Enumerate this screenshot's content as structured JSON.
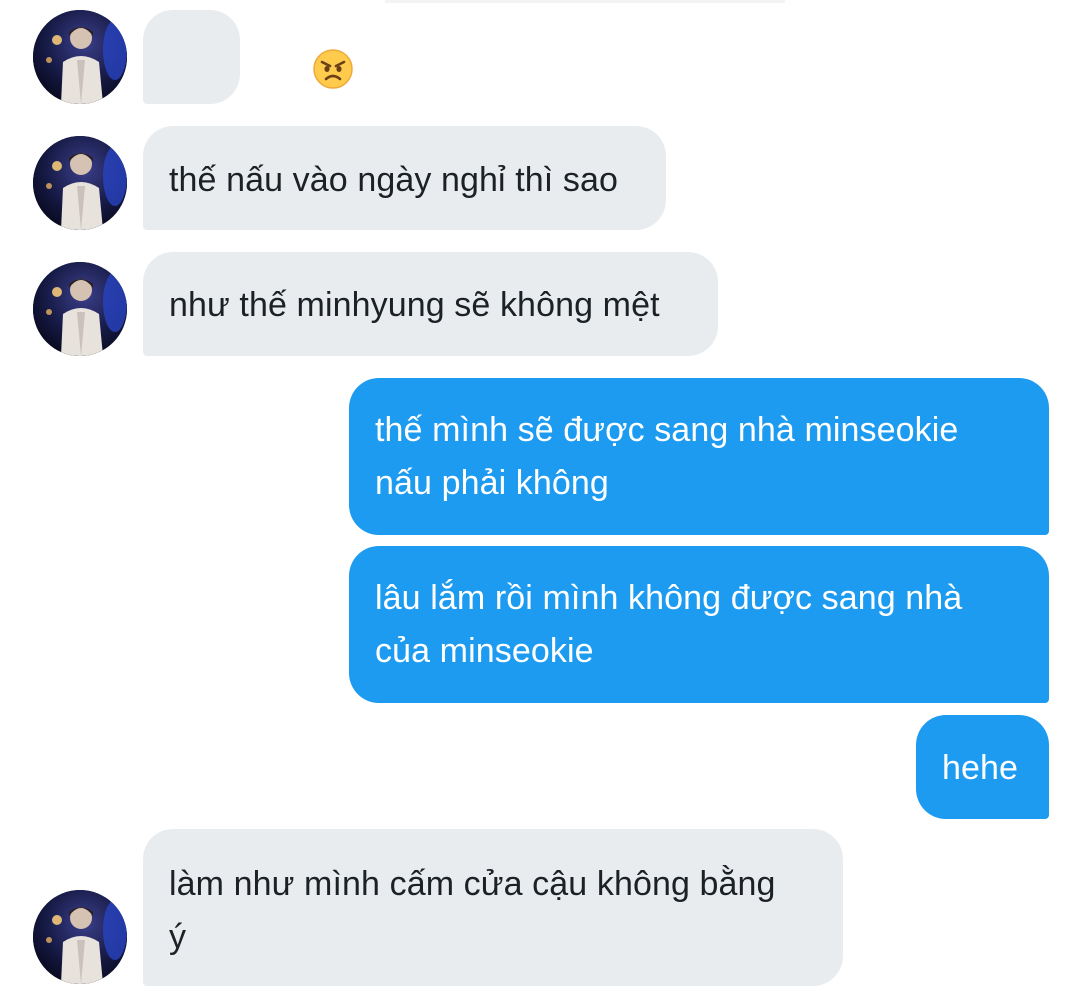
{
  "conversation": {
    "contact_avatar": "contact-avatar-photo",
    "colors": {
      "incoming_bubble": "#e9ecef",
      "outgoing_bubble": "#1d9bf0",
      "incoming_text": "#1c2126",
      "outgoing_text": "#ffffff"
    },
    "messages": [
      {
        "direction": "incoming",
        "emoji": "angry-face"
      },
      {
        "direction": "incoming",
        "text": "thế nấu vào ngày nghỉ thì sao"
      },
      {
        "direction": "incoming",
        "text": "như thế minhyung sẽ không mệt"
      },
      {
        "direction": "outgoing",
        "lines": [
          "thế mình sẽ được sang nhà minseokie",
          "nấu phải không"
        ]
      },
      {
        "direction": "outgoing",
        "lines": [
          "lâu lắm rồi mình không được sang nhà",
          "của minseokie"
        ]
      },
      {
        "direction": "outgoing",
        "text": "hehe"
      },
      {
        "direction": "incoming",
        "lines": [
          "làm như mình cấm cửa cậu không bằng",
          "ý"
        ]
      }
    ]
  }
}
